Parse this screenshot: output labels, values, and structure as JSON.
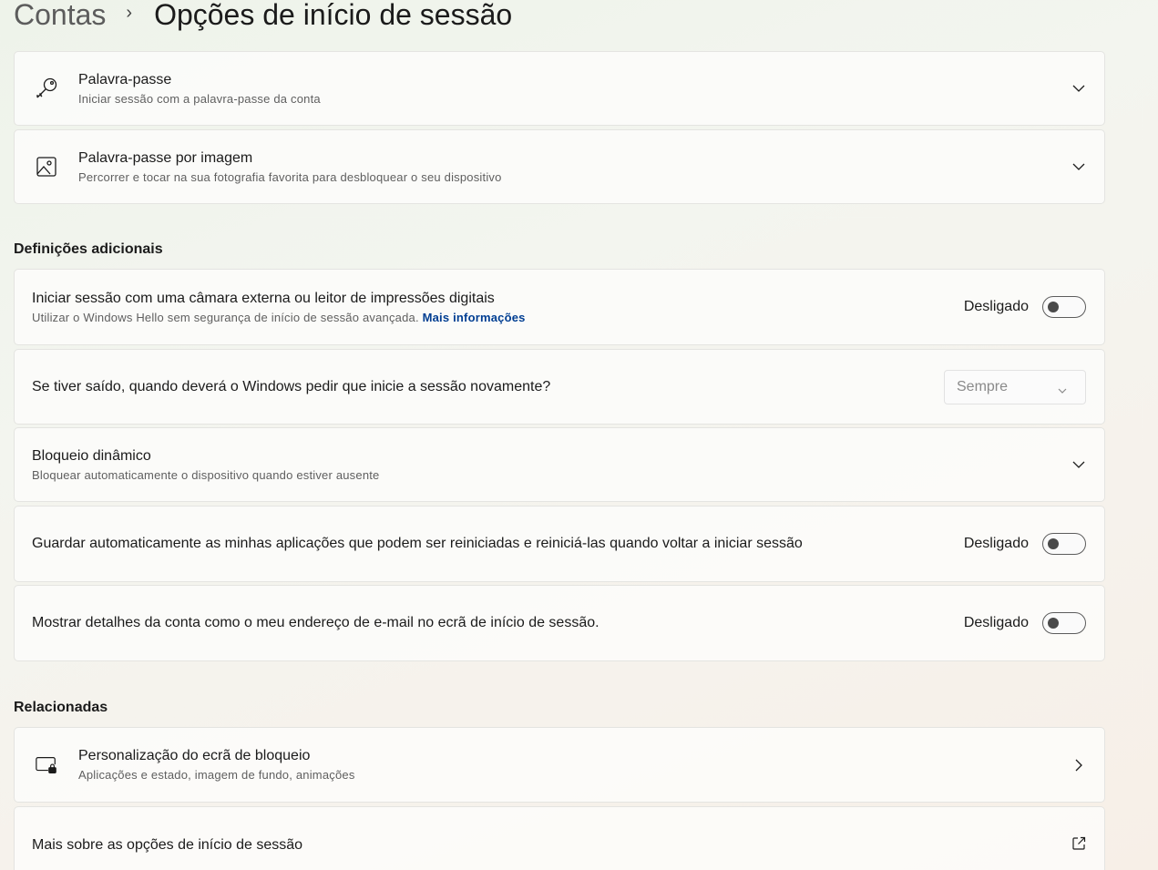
{
  "breadcrumb": {
    "parent": "Contas",
    "separator": "›",
    "current": "Opções de início de sessão"
  },
  "password": {
    "title": "Palavra-passe",
    "subtitle": "Iniciar sessão com a palavra-passe da conta",
    "icon": "key-icon"
  },
  "picture_password": {
    "title": "Palavra-passe por imagem",
    "subtitle": "Percorrer e tocar na sua fotografia favorita para desbloquear o seu dispositivo",
    "icon": "picture-icon"
  },
  "additional": {
    "heading": "Definições adicionais",
    "external_camera": {
      "title": "Iniciar sessão com uma câmara externa ou leitor de impressões digitais",
      "subtitle": "Utilizar o Windows Hello sem segurança de início de sessão avançada.",
      "link": "Mais informações",
      "state": "Desligado"
    },
    "require_signin": {
      "title": "Se tiver saído, quando deverá o Windows pedir que inicie a sessão novamente?",
      "selected": "Sempre"
    },
    "dynamic_lock": {
      "title": "Bloqueio dinâmico",
      "subtitle": "Bloquear automaticamente o dispositivo quando estiver ausente"
    },
    "restart_apps": {
      "title": "Guardar automaticamente as minhas aplicações que podem ser reiniciadas e reiniciá-las quando voltar a iniciar sessão",
      "state": "Desligado"
    },
    "account_details": {
      "title": "Mostrar detalhes da conta como o meu endereço de e-mail no ecrã de início de sessão.",
      "state": "Desligado"
    }
  },
  "related": {
    "heading": "Relacionadas",
    "lock_screen": {
      "title": "Personalização do ecrã de bloqueio",
      "subtitle": "Aplicações e estado, imagem de fundo, animações",
      "icon": "lock-screen-icon"
    },
    "more_options": {
      "title": "Mais sobre as opções de início de sessão",
      "icon": "external-link-icon"
    }
  }
}
